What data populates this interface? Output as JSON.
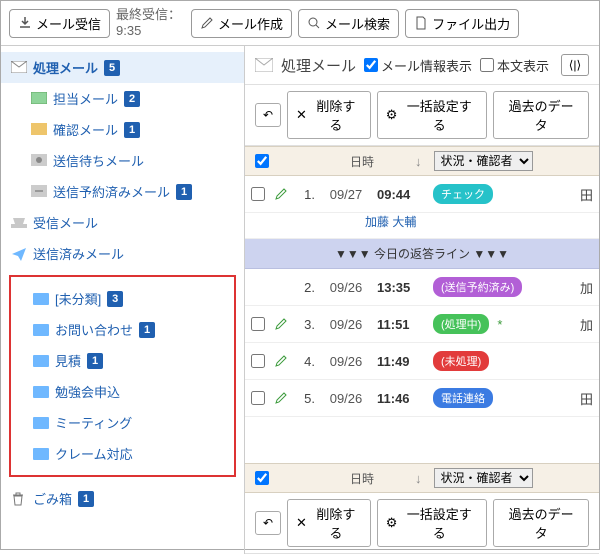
{
  "toolbar": {
    "recv": "メール受信",
    "last_label": "最終受信：",
    "last_time": "9:35",
    "compose": "メール作成",
    "search": "メール検索",
    "export": "ファイル出力"
  },
  "sidebar": {
    "proc": {
      "label": "処理メール",
      "count": "5"
    },
    "items": [
      {
        "label": "担当メール",
        "count": "2"
      },
      {
        "label": "確認メール",
        "count": "1"
      },
      {
        "label": "送信待ちメール",
        "count": ""
      },
      {
        "label": "送信予約済みメール",
        "count": "1"
      }
    ],
    "inbox": "受信メール",
    "sent": "送信済みメール",
    "folders": [
      {
        "label": "[未分類]",
        "count": "3"
      },
      {
        "label": "お問い合わせ",
        "count": "1"
      },
      {
        "label": "見積",
        "count": "1"
      },
      {
        "label": "勉強会申込",
        "count": ""
      },
      {
        "label": "ミーティング",
        "count": ""
      },
      {
        "label": "クレーム対応",
        "count": ""
      }
    ],
    "trash": {
      "label": "ごみ箱",
      "count": "1"
    }
  },
  "content": {
    "title": "処理メール",
    "chk1": "メール情報表示",
    "chk2": "本文表示",
    "delete": "削除する",
    "bulk": "一括設定する",
    "past": "過去のデータ",
    "col_date": "日時",
    "col_status": "状況・確認者",
    "reply_line": "▼▼▼ 今日の返答ライン ▼▼▼",
    "rows": [
      {
        "idx": "1.",
        "date": "09/27",
        "time": "09:44",
        "tag": "チェック",
        "cls": "t-check",
        "tail": "田",
        "sub": "加藤 大輔",
        "cb": true
      },
      {
        "idx": "2.",
        "date": "09/26",
        "time": "13:35",
        "tag": "(送信予約済み)",
        "cls": "t-yoyaku",
        "tail": "加",
        "cb": false
      },
      {
        "idx": "3.",
        "date": "09/26",
        "time": "11:51",
        "tag": "(処理中)",
        "cls": "t-proc",
        "tail": "加",
        "star": "*",
        "cb": true
      },
      {
        "idx": "4.",
        "date": "09/26",
        "time": "11:49",
        "tag": "(未処理)",
        "cls": "t-unproc",
        "tail": "",
        "cb": true
      },
      {
        "idx": "5.",
        "date": "09/26",
        "time": "11:46",
        "tag": "電話連絡",
        "cls": "t-tel",
        "tail": "田",
        "cb": true
      }
    ]
  }
}
